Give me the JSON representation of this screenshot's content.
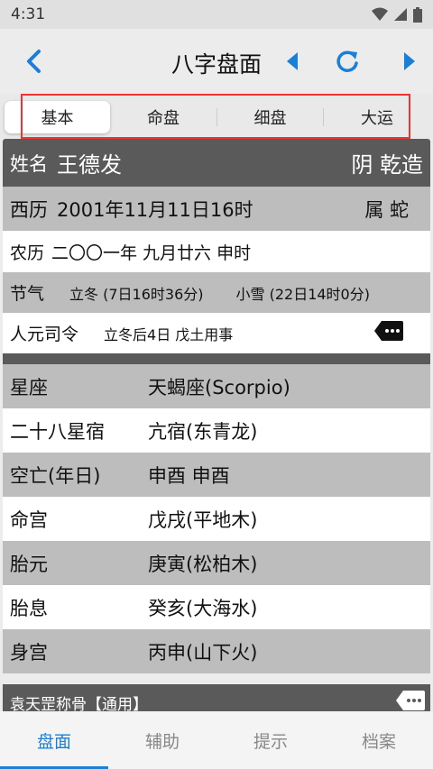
{
  "status": {
    "time": "4:31"
  },
  "header": {
    "title": "八字盘面"
  },
  "tabs": [
    "基本",
    "命盘",
    "细盘",
    "大运"
  ],
  "profile": {
    "name_label": "姓名",
    "name": "王德发",
    "gender_type": "阴 乾造"
  },
  "xili": {
    "label": "西历",
    "value": "2001年11月11日16时",
    "zodiac": "属 蛇"
  },
  "nongli": {
    "label": "农历",
    "value": "二〇〇一年 九月廿六 申时"
  },
  "jieqi": {
    "label": "节气",
    "first": "立冬 (7日16时36分)",
    "second": "小雪 (22日14时0分)"
  },
  "renyuan": {
    "label": "人元司令",
    "value": "立冬后4日 戊土用事"
  },
  "details": [
    {
      "label": "星座",
      "value": "天蝎座(Scorpio)"
    },
    {
      "label": "二十八星宿",
      "value": "亢宿(东青龙)"
    },
    {
      "label": "空亡(年日)",
      "value": "申酉 申酉"
    },
    {
      "label": "命宫",
      "value": "戊戌(平地木)"
    },
    {
      "label": "胎元",
      "value": "庚寅(松柏木)"
    },
    {
      "label": "胎息",
      "value": "癸亥(大海水)"
    },
    {
      "label": "身宫",
      "value": "丙申(山下火)"
    }
  ],
  "footer_section": {
    "label": "袁天罡称骨【通用】"
  },
  "bottom_nav": [
    "盘面",
    "辅助",
    "提示",
    "档案"
  ],
  "colors": {
    "accent": "#1a7fd6",
    "dark_row": "#5a5a5a",
    "gray_row": "#bdbdbd",
    "highlight": "#e33333"
  }
}
